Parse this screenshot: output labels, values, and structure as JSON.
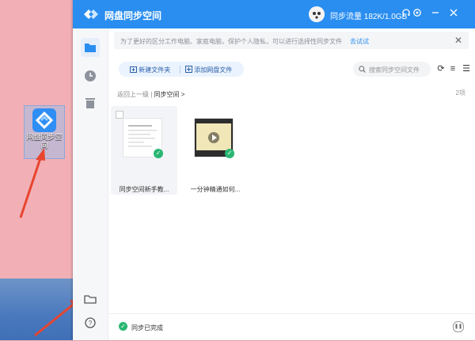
{
  "desktop": {
    "icon_caption": "网盘同步空间"
  },
  "window": {
    "app_name": "网盘同步空间",
    "traffic": "同步流量 182K/1.0GB",
    "colors": {
      "accent": "#2a8ef0",
      "success": "#2ab673"
    }
  },
  "notice": {
    "text": "为了更好的区分工作电脑、家庭电脑，保护个人隐私，可以进行选择性同步文件",
    "link": "去试试",
    "close": "✕"
  },
  "toolbar": {
    "new_folder": "新建文件夹",
    "add_file": "添加网盘文件",
    "search_placeholder": "搜索同步空间文件"
  },
  "breadcrumb": {
    "back": "返回上一级",
    "current": "同步空间",
    "arrow": ">"
  },
  "count": "2项",
  "files": [
    {
      "name": "同步空间新手教..."
    },
    {
      "name": "一分钟精通如何..."
    }
  ],
  "status": {
    "text": "同步已完成"
  }
}
